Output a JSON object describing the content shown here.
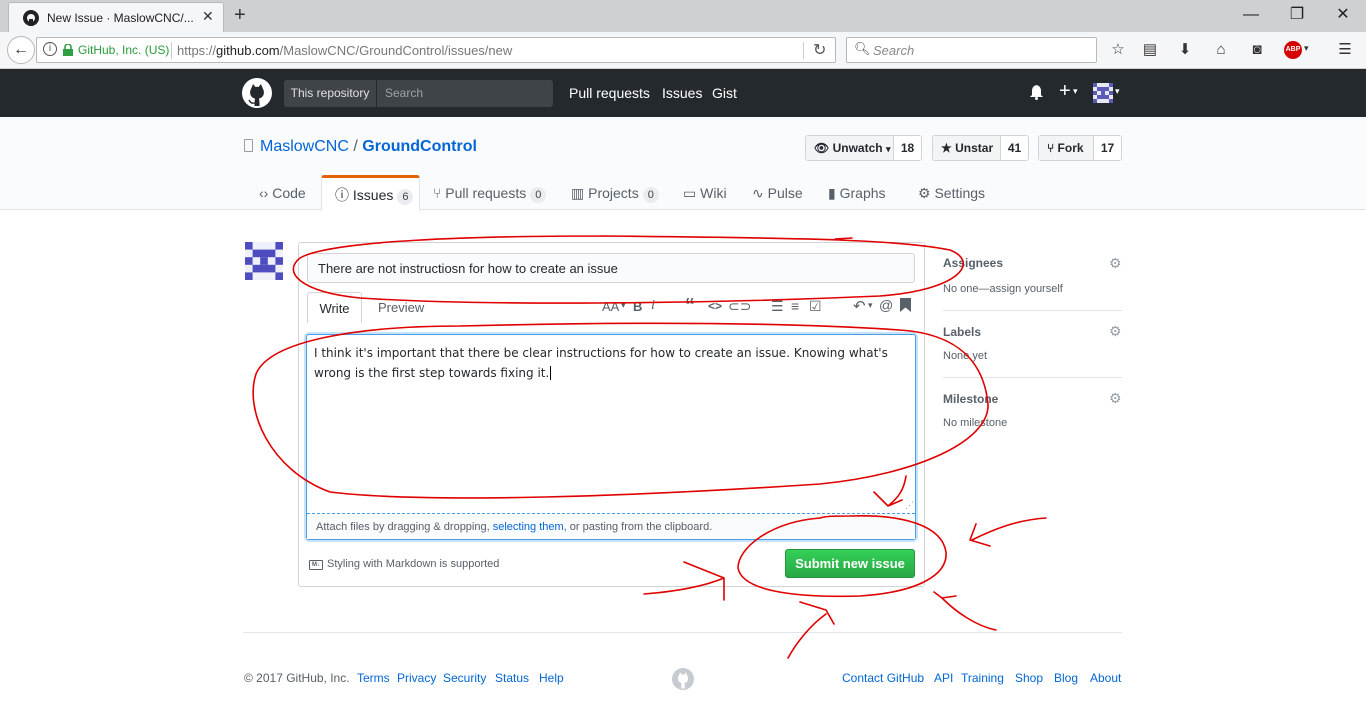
{
  "browser": {
    "tab_title": "New Issue · MaslowCNC/...",
    "new_tab": "+",
    "window_controls": {
      "minimize": "—",
      "restore": "❐",
      "close": "✕"
    },
    "site_identity": "GitHub, Inc. (US)",
    "url_prefix": "https://",
    "url_host": "github.com",
    "url_path": "/MaslowCNC/GroundControl/issues/new",
    "search_placeholder": "Search"
  },
  "header": {
    "scope_label": "This repository",
    "search_placeholder": "Search",
    "nav": [
      "Pull requests",
      "Issues",
      "Gist"
    ]
  },
  "repo": {
    "owner": "MaslowCNC",
    "separator": "/",
    "name": "GroundControl",
    "watch_label": "Unwatch",
    "watch_count": "18",
    "star_label": "Unstar",
    "star_count": "41",
    "fork_label": "Fork",
    "fork_count": "17",
    "tabs": [
      {
        "label": "Code",
        "count": ""
      },
      {
        "label": "Issues",
        "count": "6"
      },
      {
        "label": "Pull requests",
        "count": "0"
      },
      {
        "label": "Projects",
        "count": "0"
      },
      {
        "label": "Wiki",
        "count": ""
      },
      {
        "label": "Pulse",
        "count": ""
      },
      {
        "label": "Graphs",
        "count": ""
      },
      {
        "label": "Settings",
        "count": ""
      }
    ]
  },
  "form": {
    "title_value": "There are not instructiosn for how to create an issue",
    "write_tab": "Write",
    "preview_tab": "Preview",
    "toolbar": {
      "heading": "AA",
      "bold": "B",
      "italic": "i",
      "quote": "“",
      "code": "<>",
      "mention": "@"
    },
    "body_value": "I think it's important that there be clear instructions for how to create an issue. Knowing what's wrong is the first step towards fixing it.",
    "attach_prefix": "Attach files by dragging & dropping, ",
    "attach_link": "selecting them",
    "attach_suffix": ", or pasting from the clipboard.",
    "markdown_note": "Styling with Markdown is supported",
    "submit_label": "Submit new issue"
  },
  "sidebar": {
    "assignees_label": "Assignees",
    "assignees_value": "No one—assign yourself",
    "labels_label": "Labels",
    "labels_value": "None yet",
    "milestone_label": "Milestone",
    "milestone_value": "No milestone"
  },
  "footer": {
    "copyright": "© 2017 GitHub, Inc.",
    "left_links": [
      "Terms",
      "Privacy",
      "Security",
      "Status",
      "Help"
    ],
    "right_links": [
      "Contact GitHub",
      "API",
      "Training",
      "Shop",
      "Blog",
      "About"
    ]
  },
  "colors": {
    "header_bg": "#24292e",
    "submit_green": "#2cbe4e",
    "link_blue": "#0366d6",
    "active_tab_accent": "#e36209",
    "annotation_red": "#e00000",
    "focus_blue": "#4a9ee8"
  }
}
